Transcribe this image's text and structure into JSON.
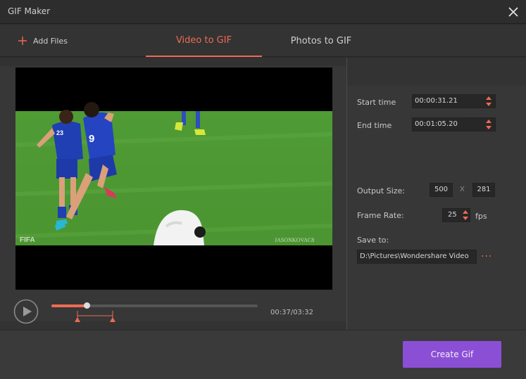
{
  "window": {
    "title": "GIF Maker"
  },
  "toolbar": {
    "add_files_label": "Add Files"
  },
  "tabs": [
    {
      "label": "Video to GIF",
      "active": true
    },
    {
      "label": "Photos to GIF",
      "active": false
    }
  ],
  "player": {
    "current_time": "00:37",
    "duration": "03:32",
    "time_readout": "00:37/03:32",
    "progress_fraction": 0.17,
    "watermark_left": "FIFA",
    "watermark_right": "JASONKOVAC8",
    "jersey_numbers": [
      "23",
      "9"
    ]
  },
  "settings": {
    "start_time_label": "Start time",
    "start_time_value": "00:00:31.21",
    "end_time_label": "End time",
    "end_time_value": "00:01:05.20",
    "output_size_label": "Output Size:",
    "output_width": "500",
    "size_separator": "X",
    "output_height": "281",
    "frame_rate_label": "Frame Rate:",
    "frame_rate_value": "25",
    "frame_rate_unit": "fps",
    "save_to_label": "Save to:",
    "save_path": "D:\\Pictures\\Wondershare Video",
    "more_label": "···"
  },
  "footer": {
    "create_label": "Create Gif"
  },
  "colors": {
    "accent": "#ee6b53",
    "button": "#8b4fd6",
    "pitch": "#4e9a33"
  },
  "icons": [
    "close-icon",
    "plus-icon",
    "play-icon",
    "spin-arrows-icon",
    "range-marker-icon"
  ]
}
